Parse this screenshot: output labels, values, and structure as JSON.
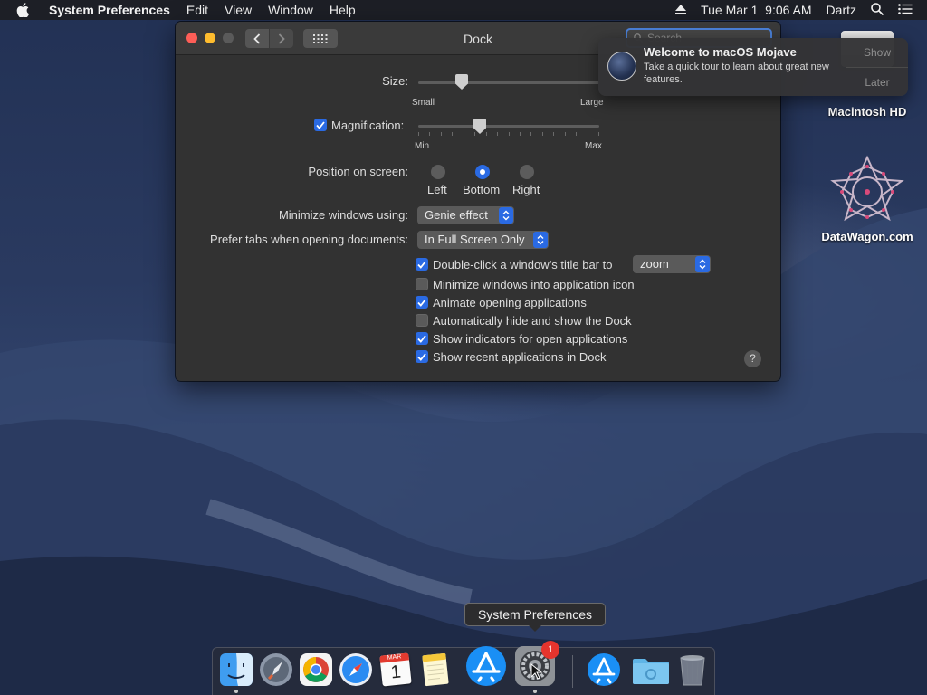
{
  "menubar": {
    "app_name": "System Preferences",
    "menus": [
      "Edit",
      "View",
      "Window",
      "Help"
    ],
    "datetime": "Tue Mar 1  9:06 AM",
    "user": "Dartz"
  },
  "window": {
    "title": "Dock",
    "search_placeholder": "Search"
  },
  "size": {
    "label": "Size:",
    "min_label": "Small",
    "max_label": "Large",
    "value_fraction": 0.24
  },
  "magnification": {
    "label": "Magnification:",
    "checked": true,
    "min_label": "Min",
    "max_label": "Max",
    "value_fraction": 0.34
  },
  "position": {
    "label": "Position on screen:",
    "options": [
      "Left",
      "Bottom",
      "Right"
    ],
    "selected": "Bottom"
  },
  "minimize": {
    "label": "Minimize windows using:",
    "value": "Genie effect"
  },
  "prefer_tabs": {
    "label": "Prefer tabs when opening documents:",
    "value": "In Full Screen Only"
  },
  "checkboxes": {
    "double_click": {
      "label": "Double-click a window’s title bar to",
      "checked": true,
      "action_value": "zoom"
    },
    "minimize_into_icon": {
      "label": "Minimize windows into application icon",
      "checked": false
    },
    "animate": {
      "label": "Animate opening applications",
      "checked": true
    },
    "autohide": {
      "label": "Automatically hide and show the Dock",
      "checked": false
    },
    "indicators": {
      "label": "Show indicators for open applications",
      "checked": true
    },
    "recent": {
      "label": "Show recent applications in Dock",
      "checked": true
    }
  },
  "help_label": "?",
  "notification": {
    "title": "Welcome to macOS Mojave",
    "body": "Take a quick tour to learn about great new features.",
    "show_label": "Show",
    "later_label": "Later"
  },
  "desktop": {
    "icons": [
      {
        "label": "Macintosh HD"
      },
      {
        "label": "DataWagon.com"
      }
    ]
  },
  "dock": {
    "tooltip": "System Preferences",
    "badge_count": "1",
    "calendar_month": "MAR",
    "calendar_day": "1",
    "items": [
      "finder-icon",
      "launchpad-icon",
      "chrome-icon",
      "safari-icon",
      "calendar-icon",
      "notes-icon",
      "app-store-icon",
      "system-preferences-icon",
      "app-store-icon",
      "downloads-folder-icon",
      "trash-icon"
    ]
  },
  "colors": {
    "accent": "#2a6ae3",
    "window_bg": "#323232",
    "badge": "#e5342d"
  }
}
